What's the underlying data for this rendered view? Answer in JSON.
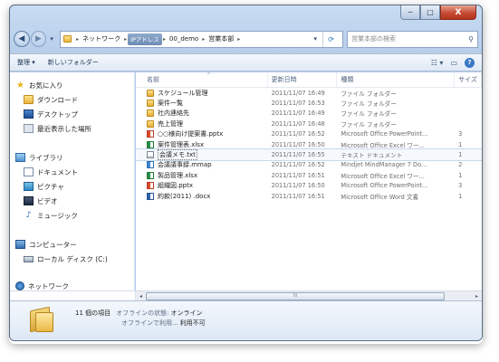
{
  "window": {
    "caption_buttons": {
      "minimize": "─",
      "maximize": "□",
      "close": "X"
    }
  },
  "address_bar": {
    "crumbs": [
      "ネットワーク",
      "IPアドレス",
      "00_demo",
      "営業本部"
    ],
    "refresh_icon": "refresh-icon"
  },
  "search": {
    "placeholder": "営業本部の検索"
  },
  "toolbar": {
    "organize": "整理 ▾",
    "new_folder": "新しいフォルダー"
  },
  "nav": {
    "favorites": {
      "label": "お気に入り",
      "items": [
        "ダウンロード",
        "デスクトップ",
        "最近表示した場所"
      ]
    },
    "libraries": {
      "label": "ライブラリ",
      "items": [
        "ドキュメント",
        "ピクチャ",
        "ビデオ",
        "ミュージック"
      ]
    },
    "computer": {
      "label": "コンピューター",
      "items": [
        "ローカル ディスク (C:)"
      ]
    },
    "network": {
      "label": "ネットワーク"
    }
  },
  "columns": {
    "name": "名前",
    "date": "更新日時",
    "type": "種類",
    "size": "サイズ"
  },
  "files": [
    {
      "name": "スケジュール管理",
      "date": "2011/11/07 16:49",
      "type": "ファイル フォルダー",
      "size": "",
      "icon": "folder"
    },
    {
      "name": "案件一覧",
      "date": "2011/11/07 16:53",
      "type": "ファイル フォルダー",
      "size": "",
      "icon": "folder"
    },
    {
      "name": "社内連絡先",
      "date": "2011/11/07 16:49",
      "type": "ファイル フォルダー",
      "size": "",
      "icon": "folder"
    },
    {
      "name": "売上管理",
      "date": "2011/11/07 16:48",
      "type": "ファイル フォルダー",
      "size": "",
      "icon": "folder"
    },
    {
      "name": "○○様向け提案書.pptx",
      "date": "2011/11/07 16:52",
      "type": "Microsoft Office PowerPoint...",
      "size": "3",
      "icon": "pptx"
    },
    {
      "name": "案件管理表.xlsx",
      "date": "2011/11/07 16:50",
      "type": "Microsoft Office Excel ワー...",
      "size": "1",
      "icon": "xlsx"
    },
    {
      "name": "会議メモ.txt",
      "date": "2011/11/07 16:55",
      "type": "テキスト ドキュメント",
      "size": "1",
      "icon": "txt",
      "selected": true
    },
    {
      "name": "会議議事録.mmap",
      "date": "2011/11/07 16:52",
      "type": "Mindjet MindManager 7 Do...",
      "size": "2",
      "icon": "mmap"
    },
    {
      "name": "製品管理.xlsx",
      "date": "2011/11/07 16:51",
      "type": "Microsoft Office Excel ワー...",
      "size": "1",
      "icon": "xlsx"
    },
    {
      "name": "組織図.pptx",
      "date": "2011/11/07 16:50",
      "type": "Microsoft Office PowerPoint...",
      "size": "3",
      "icon": "pptx"
    },
    {
      "name": "約款(2011) .docx",
      "date": "2011/11/07 16:51",
      "type": "Microsoft Office Word 文書",
      "size": "1",
      "icon": "docx"
    }
  ],
  "scrollbar": {
    "thumb_grip": "III"
  },
  "details": {
    "count": "11 個の項目",
    "offline_status_label": "オフラインの状態:",
    "offline_status_value": "オンライン",
    "offline_use_label": "オフラインで利用...",
    "offline_use_value": "利用不可"
  }
}
